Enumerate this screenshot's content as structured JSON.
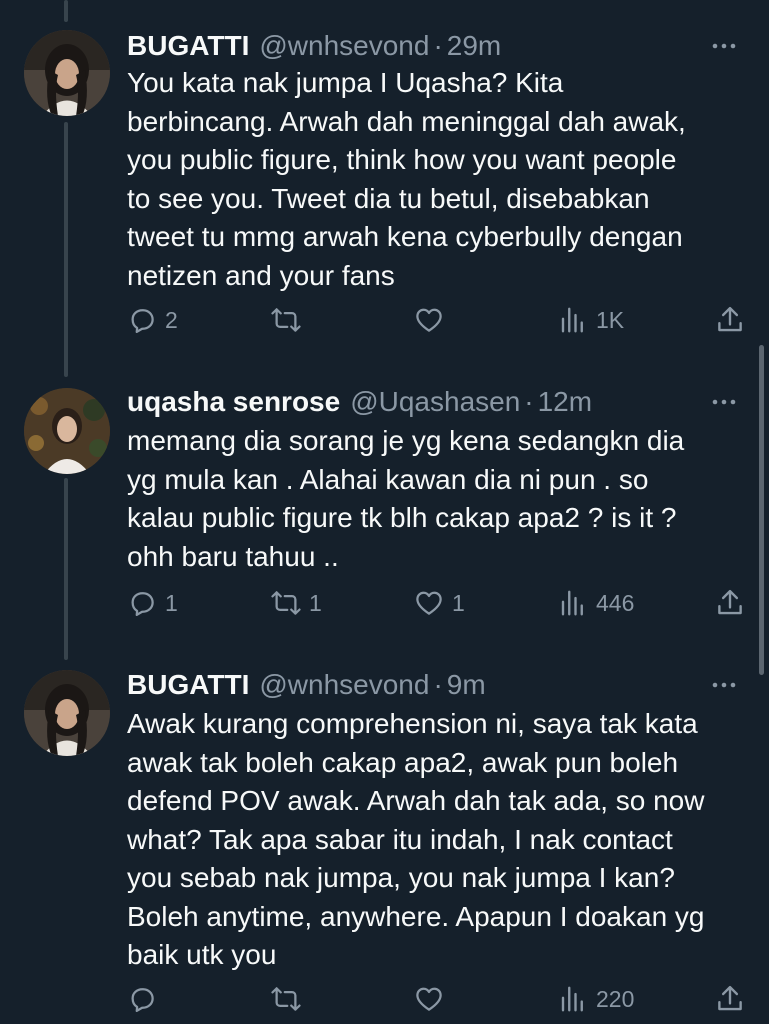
{
  "tweets": [
    {
      "name": "BUGATTI",
      "handle": "@wnhsevond",
      "dot": "·",
      "time": "29m",
      "text": "You kata nak jumpa I Uqasha? Kita\nberbincang. Arwah dah meninggal dah awak,\nyou public figure, think how you want people\nto see you. Tweet dia tu betul, disebabkan\ntweet tu mmg arwah kena cyberbully dengan\nnetizen and your fans",
      "replies": "2",
      "retweets": "",
      "likes": "",
      "views": "1K"
    },
    {
      "name": "uqasha senrose",
      "handle": "@Uqashasen",
      "dot": "·",
      "time": "12m",
      "text": "memang dia sorang je yg kena sedangkn dia\nyg mula kan . Alahai kawan dia ni pun . so\nkalau public figure tk blh cakap apa2 ? is it ?\nohh baru tahuu ..",
      "replies": "1",
      "retweets": "1",
      "likes": "1",
      "views": "446"
    },
    {
      "name": "BUGATTI",
      "handle": "@wnhsevond",
      "dot": "·",
      "time": "9m",
      "text": "Awak kurang comprehension ni, saya tak kata\nawak tak boleh cakap apa2, awak pun boleh\ndefend POV awak. Arwah dah tak ada, so now\nwhat? Tak apa sabar itu indah, I nak contact\nyou sebab nak jumpa, you nak jumpa I kan?\nBoleh anytime, anywhere. Apapun I doakan yg\nbaik utk you",
      "replies": "",
      "retweets": "",
      "likes": "",
      "views": "220"
    }
  ],
  "icons": {
    "reply": "reply-icon",
    "retweet": "retweet-icon",
    "like": "like-icon",
    "views": "views-icon",
    "share": "share-icon",
    "more": "more-icon"
  },
  "colors": {
    "background": "#15202b",
    "text": "#f7f9f9",
    "secondary": "#8b98a5",
    "thread_line": "#38444d"
  }
}
